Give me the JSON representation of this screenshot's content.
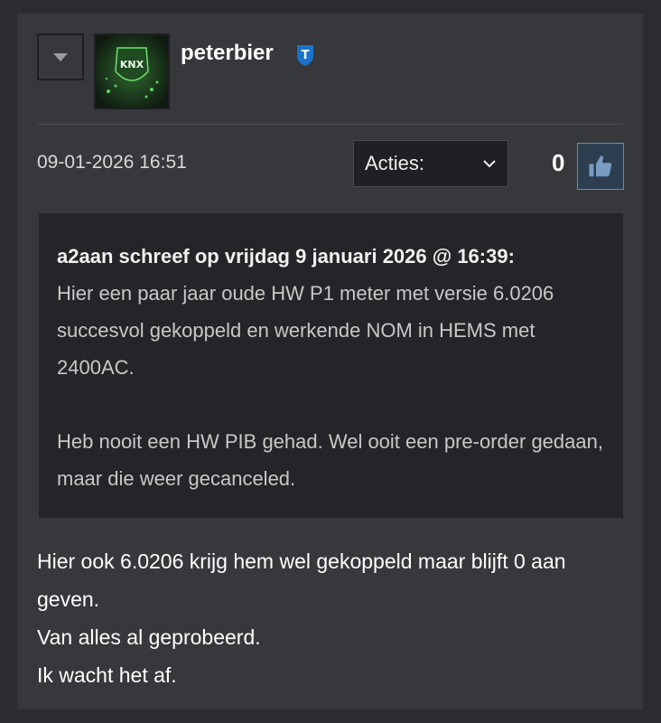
{
  "post": {
    "username": "peterbier",
    "badge_letter": "T",
    "avatar_text": "KNX",
    "date": "09-01-2026 16:51",
    "actions_label": "Acties:",
    "like_count": "0",
    "quote": {
      "header": "a2aan schreef op vrijdag 9 januari 2026 @ 16:39:",
      "paragraph1": "Hier een paar jaar oude HW P1 meter met versie 6.0206 succesvol gekoppeld en werkende NOM in HEMS met 2400AC.",
      "paragraph2": "Heb nooit een HW PIB gehad. Wel ooit een pre-order gedaan, maar die weer gecanceled."
    },
    "message_lines": [
      "Hier ook 6.0206 krijg hem wel gekoppeld maar blijft 0 aan geven.",
      "Van alles al geprobeerd.",
      "Ik wacht het af."
    ]
  },
  "colors": {
    "background": "#2a2c2f",
    "card": "#36383b",
    "quote_bg": "#242528",
    "like_accent": "#6c8db0"
  },
  "icons": [
    "collapse-triangle-icon",
    "tweakers-badge-icon",
    "chevron-down-icon",
    "thumbs-up-icon"
  ]
}
